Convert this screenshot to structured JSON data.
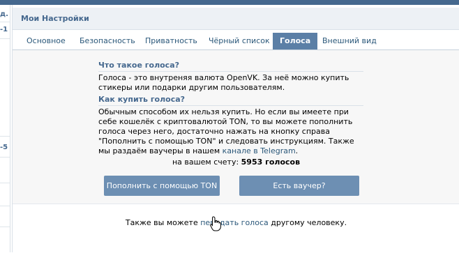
{
  "left_fragments": [
    "д.",
    "-1",
    "-5"
  ],
  "header": {
    "title": "Мои Настройки"
  },
  "tabs": [
    {
      "label": "Основное"
    },
    {
      "label": "Безопасность"
    },
    {
      "label": "Приватность"
    },
    {
      "label": "Чёрный список"
    },
    {
      "label": "Голоса",
      "active": true
    },
    {
      "label": "Внешний вид"
    }
  ],
  "section1": {
    "heading": "Что такое голоса?",
    "text": "Голоса - это внутреняя валюта OpenVK. За неё можно купить стикеры или подарки другим пользователям."
  },
  "section2": {
    "heading": "Как купить голоса?",
    "text": "Обычным способом их нельзя купить. Но если вы имеете при себе кошелёк с криптовалютой TON, то вы можете пополнить голоса через него, достаточно нажать на кнопку справа \"Пополнить с помощью TON\" и следовать инструкциям. Также мы раздаём ваучеры в нашем ",
    "link": "канале в Telegram",
    "tail": "."
  },
  "balance": {
    "label": "на вашем счету:",
    "value": "5953 голосов"
  },
  "buttons": {
    "topup": "Пополнить с помощью TON",
    "voucher": "Есть ваучер?"
  },
  "footer": {
    "before": "Также вы можете ",
    "link": "передать голоса",
    "after": " другому человеку."
  }
}
